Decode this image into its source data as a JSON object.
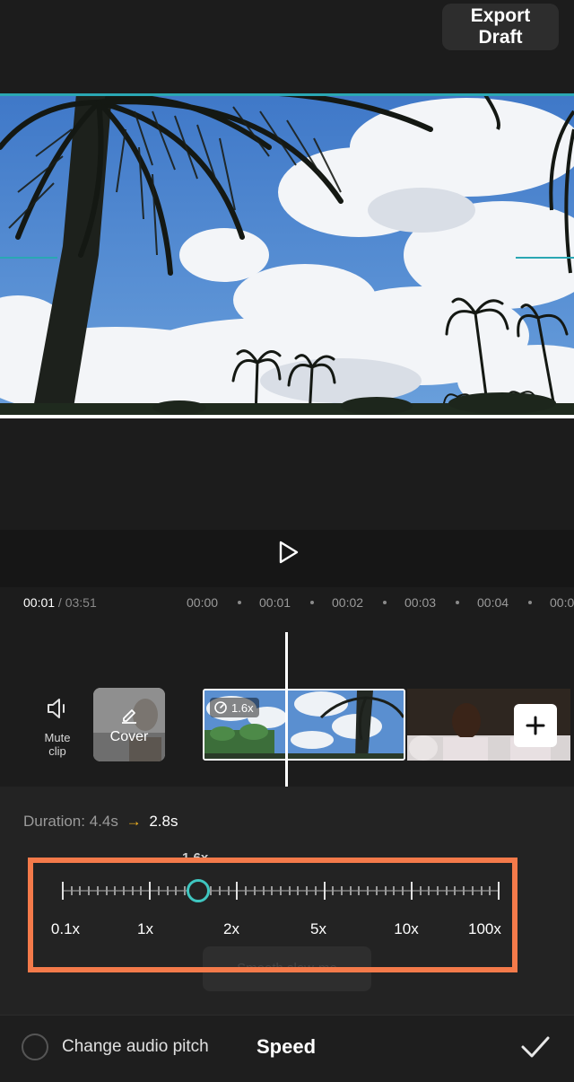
{
  "header": {
    "export_line1": "Export",
    "export_line2": "Draft"
  },
  "playback": {
    "current_time": "00:01",
    "separator": " / ",
    "total_time": "03:51",
    "ruler": [
      "00:00",
      "00:01",
      "00:02",
      "00:03",
      "00:04",
      "00:0"
    ]
  },
  "tools": {
    "mute_line1": "Mute",
    "mute_line2": "clip",
    "cover": "Cover"
  },
  "clip": {
    "speed_badge": "1.6x"
  },
  "speed_panel": {
    "duration_label": "Duration:",
    "duration_old": "4.4s",
    "duration_arrow": "→",
    "duration_new": "2.8s",
    "current_value": "1.6x",
    "current_fraction": 0.3,
    "scale_labels": [
      "0.1x",
      "1x",
      "2x",
      "5x",
      "10x",
      "100x"
    ],
    "smooth_label": "Smooth slow-mo"
  },
  "bottom": {
    "pitch_label": "Change audio pitch",
    "title": "Speed"
  },
  "colors": {
    "accent": "#3fc6c0",
    "highlight": "#f47a4a",
    "arrow": "#f2b321"
  },
  "icons": {
    "play": "play-icon",
    "mute": "speaker-icon",
    "cover": "edit-pen-icon",
    "add": "plus-icon",
    "confirm": "checkmark-icon",
    "speed": "speedometer-icon"
  }
}
